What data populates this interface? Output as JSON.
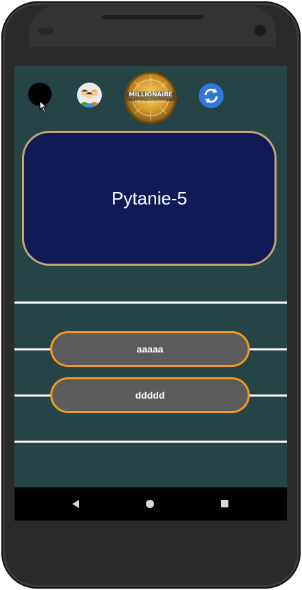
{
  "colors": {
    "screen_bg": "#254445",
    "question_bg": "#101b56",
    "question_border": "#c6a57a",
    "answer_bg": "#5b5b5b",
    "answer_border": "#f39a1a",
    "line": "#ffffff"
  },
  "toolbar": {
    "record_icon": "black-circle",
    "team_icon": "people-group",
    "logo_title": "MILLIONAIRE",
    "logo_subtitle": "MEGA QUESTIONS",
    "refresh_icon": "refresh"
  },
  "question": {
    "text": "Pytanie-5"
  },
  "answers": [
    {
      "label": "aaaaa"
    },
    {
      "label": "ddddd"
    }
  ]
}
